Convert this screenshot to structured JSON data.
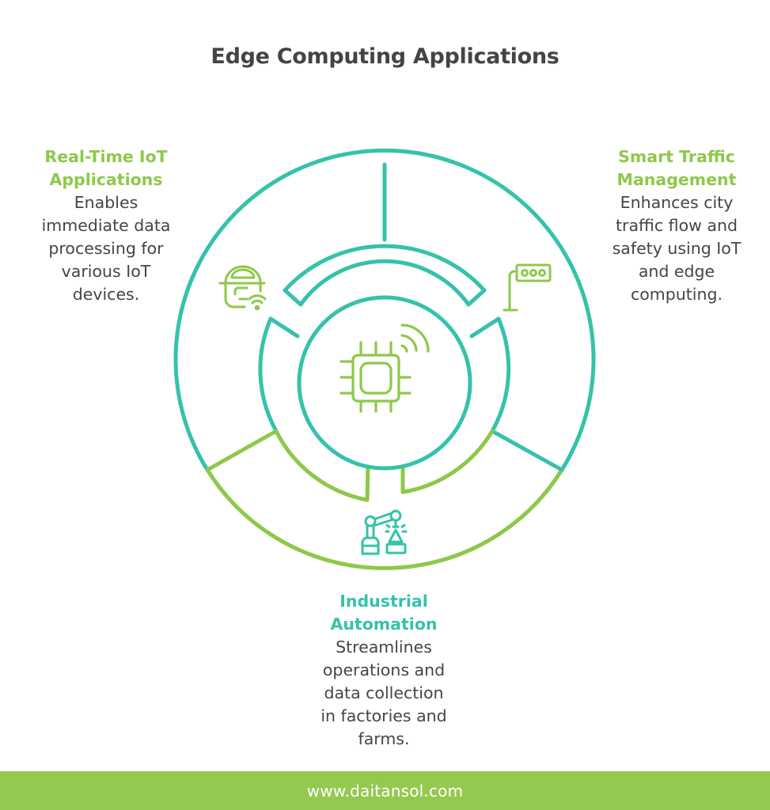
{
  "title": "Edge Computing Applications",
  "colors": {
    "teal": "#35c2aa",
    "green": "#8ec84a",
    "text": "#454545",
    "footer_bg": "#94c950"
  },
  "center": {
    "icon": "microchip-wireless-icon"
  },
  "segments": [
    {
      "id": "real-time-iot",
      "heading": "Real-Time IoT Applications",
      "heading_lines": [
        "Real-Time IoT",
        "Applications"
      ],
      "description_lines": [
        "Enables",
        "immediate data",
        "processing for",
        "various IoT",
        "devices."
      ],
      "icon": "smart-device-wifi-icon",
      "color": "green"
    },
    {
      "id": "smart-traffic",
      "heading": "Smart Traffic Management",
      "heading_lines": [
        "Smart Traffic",
        "Management"
      ],
      "description_lines": [
        "Enhances city",
        "traffic flow and",
        "safety using IoT",
        "and edge",
        "computing."
      ],
      "icon": "traffic-light-icon",
      "color": "green"
    },
    {
      "id": "industrial-automation",
      "heading": "Industrial Automation",
      "heading_lines": [
        "Industrial",
        "Automation"
      ],
      "description_lines": [
        "Streamlines",
        "operations and",
        "data collection",
        "in factories and",
        "farms."
      ],
      "icon": "robotic-arm-icon",
      "color": "teal"
    }
  ],
  "footer": {
    "url": "www.daitansol.com"
  }
}
